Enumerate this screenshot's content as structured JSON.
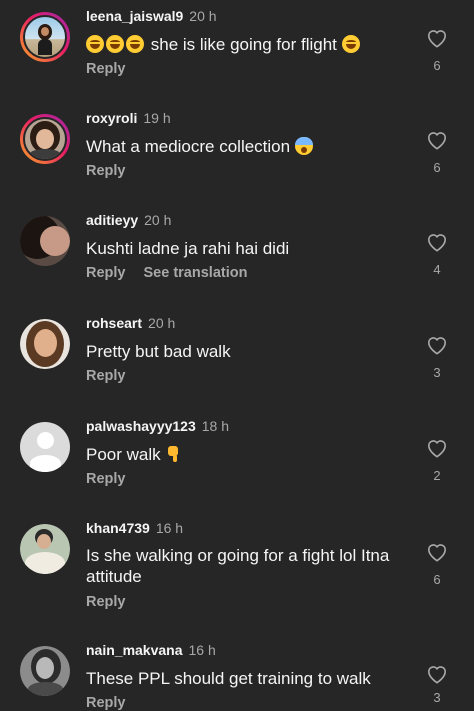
{
  "comments": [
    {
      "username": "leena_jaiswal9",
      "time": "20 h",
      "text": "she is like going for flight",
      "emoji_before": [
        "laughing-emoji",
        "laughing-emoji",
        "laughing-emoji"
      ],
      "emoji_after": [
        "laughing-emoji"
      ],
      "reply": "Reply",
      "likes": "6",
      "avatar_story_ring": true
    },
    {
      "username": "roxyroli",
      "time": "19 h",
      "text": "What a mediocre collection",
      "emoji_after": [
        "screaming-face-emoji"
      ],
      "reply": "Reply",
      "likes": "6",
      "avatar_story_ring": true
    },
    {
      "username": "aditieyy",
      "time": "20 h",
      "text": "Kushti ladne ja rahi hai didi",
      "reply": "Reply",
      "see_translation": "See translation",
      "likes": "4",
      "avatar_story_ring": false
    },
    {
      "username": "rohseart",
      "time": "20 h",
      "text": "Pretty but bad walk",
      "reply": "Reply",
      "likes": "3",
      "avatar_story_ring": false
    },
    {
      "username": "palwashayyy123",
      "time": "18 h",
      "text": "Poor walk",
      "emoji_after": [
        "thumbs-down-emoji"
      ],
      "reply": "Reply",
      "likes": "2",
      "avatar_story_ring": false
    },
    {
      "username": "khan4739",
      "time": "16 h",
      "text": "Is she walking or going for a fight lol Itna attitude",
      "reply": "Reply",
      "likes": "6",
      "avatar_story_ring": false
    },
    {
      "username": "nain_makvana",
      "time": "16 h",
      "text": "These PPL should get training to walk",
      "reply": "Reply",
      "likes": "3",
      "avatar_story_ring": false
    }
  ],
  "colors": {
    "background": "#262626",
    "primary_text": "#f5f5f5",
    "secondary_text": "#a8a8a8",
    "story_ring": [
      "#f9a825",
      "#e91e63",
      "#9c27b0"
    ]
  }
}
